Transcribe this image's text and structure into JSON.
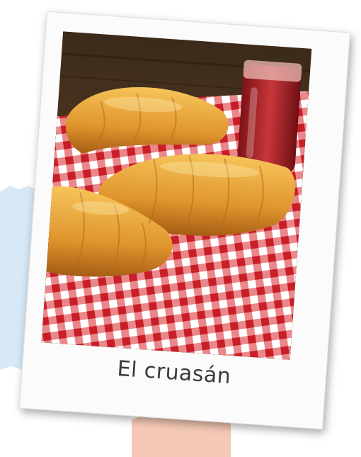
{
  "card": {
    "caption": "El cruasán",
    "photo_icon": "croissant-photo"
  },
  "colors": {
    "paper_blue": "#d7e9f6",
    "paper_peach": "#f5c9b6",
    "tablecloth_red": "#d8242c",
    "croissant": "#e9a63a",
    "jam": "#b3262b"
  }
}
